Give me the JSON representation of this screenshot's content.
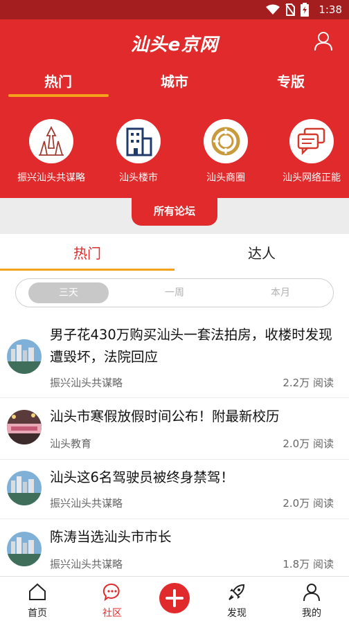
{
  "status_bar": {
    "time": "1:38"
  },
  "header": {
    "logo": "汕头e京网"
  },
  "top_tabs": [
    "热门",
    "城市",
    "专版"
  ],
  "forums": [
    "振兴汕头共谋略",
    "汕头楼市",
    "汕头商圈",
    "汕头网络正能"
  ],
  "all_forums_label": "所有论坛",
  "sub_tabs": [
    "热门",
    "达人"
  ],
  "segments": [
    "三天",
    "一周",
    "本月"
  ],
  "posts": [
    {
      "title": "男子花430万购买汕头一套法拍房，收楼时发现遭毁坏，法院回应",
      "forum": "振兴汕头共谋略",
      "reads": "2.2万 阅读"
    },
    {
      "title": "汕头市寒假放假时间公布！附最新校历",
      "forum": "汕头教育",
      "reads": "2.0万 阅读"
    },
    {
      "title": "汕头这6名驾驶员被终身禁驾！",
      "forum": "振兴汕头共谋略",
      "reads": "2.0万 阅读"
    },
    {
      "title": "陈涛当选汕头市市长",
      "forum": "振兴汕头共谋略",
      "reads": "1.8万 阅读"
    }
  ],
  "bottom_nav": {
    "home": "首页",
    "community": "社区",
    "discover": "发现",
    "mine": "我的"
  },
  "colors": {
    "brand_red": "#e02a2b",
    "accent_orange": "#f4a11c"
  }
}
